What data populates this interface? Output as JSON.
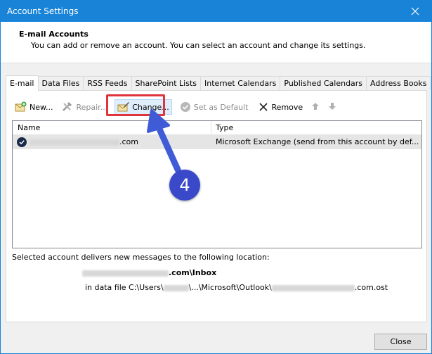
{
  "window": {
    "title": "Account Settings"
  },
  "header": {
    "title": "E-mail Accounts",
    "description": "You can add or remove an account. You can select an account and change its settings."
  },
  "tabs": [
    {
      "label": "E-mail",
      "active": true
    },
    {
      "label": "Data Files"
    },
    {
      "label": "RSS Feeds"
    },
    {
      "label": "SharePoint Lists"
    },
    {
      "label": "Internet Calendars"
    },
    {
      "label": "Published Calendars"
    },
    {
      "label": "Address Books"
    }
  ],
  "toolbar": {
    "new_label": "New...",
    "repair_label": "Repair...",
    "change_label": "Change...",
    "set_default_label": "Set as Default",
    "remove_label": "Remove"
  },
  "list": {
    "columns": {
      "name": "Name",
      "type": "Type"
    },
    "rows": [
      {
        "name_suffix": ".com",
        "type": "Microsoft Exchange (send from this account by def..."
      }
    ]
  },
  "delivery": {
    "label": "Selected account delivers new messages to the following location:",
    "inbox_suffix": ".com\\Inbox",
    "datafile_prefix": "in data file C:\\Users\\",
    "datafile_mid": "\\...\\Microsoft\\Outlook\\",
    "datafile_suffix": ".com.ost"
  },
  "annotation": {
    "step": "4"
  },
  "footer": {
    "close_label": "Close"
  },
  "colors": {
    "titlebar": "#1883d7",
    "callout": "#e0343d",
    "badge": "#3949c9",
    "arrow": "#3f5bd6"
  }
}
